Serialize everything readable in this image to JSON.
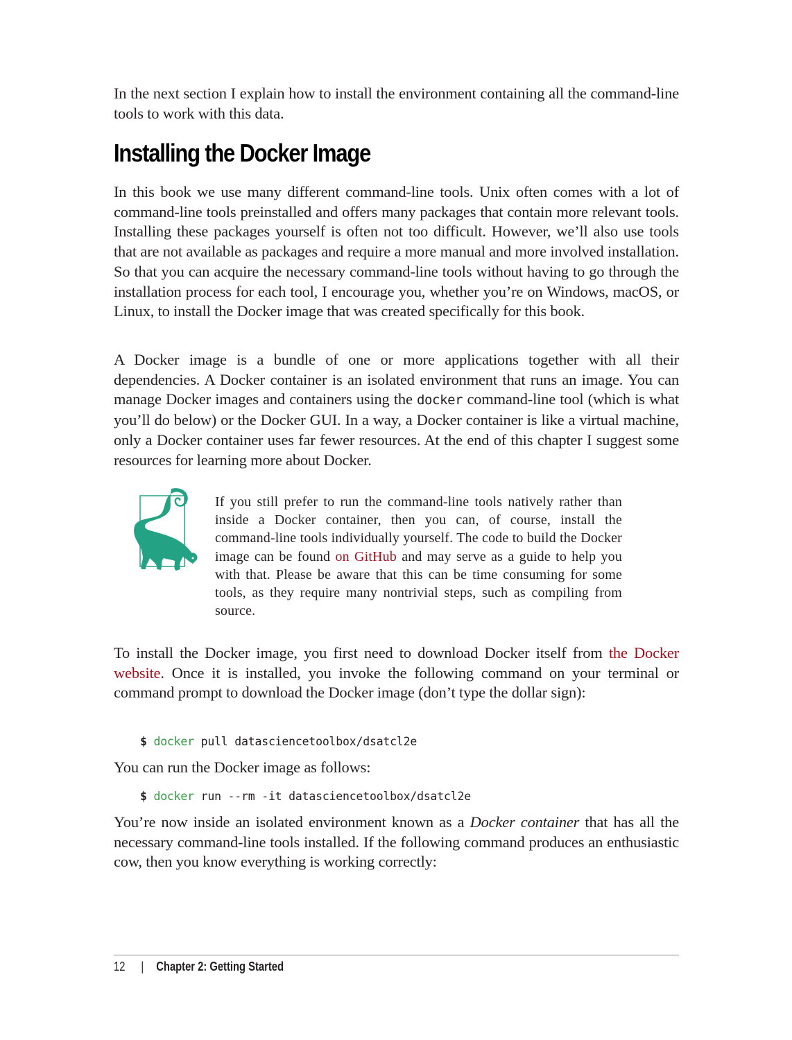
{
  "intro_paragraph": {
    "text": "In the next section I explain how to install the environment containing all the command-line tools to work with this data."
  },
  "section_heading": "Installing the Docker Image",
  "paragraph_1": "In this book we use many different command-line tools. Unix often comes with a lot of command-line tools preinstalled and offers many packages that contain more relevant tools. Installing these packages yourself is often not too difficult. However, we’ll also use tools that are not available as packages and require a more manual and more involved installation. So that you can acquire the necessary command-line tools without having to go through the installation process for each tool, I encourage you, whether you’re on Windows, macOS, or Linux, to install the Docker image that was created specifically for this book.",
  "paragraph_2": {
    "before": "A Docker image is a bundle of one or more applications together with all their dependencies. A Docker container is an isolated environment that runs an image. You can manage Docker images and containers using the ",
    "code": "docker",
    "after": " command-line tool (which is what you’ll do below) or the Docker GUI. In a way, a Docker container is like a virtual machine, only a Docker container uses far fewer resources. At the end of this chapter I suggest some resources for learning more about Docker."
  },
  "tip_note": {
    "icon": "lemur-tip-icon",
    "before": "If you still prefer to run the command-line tools natively rather than inside a Docker container, then you can, of course, install the command-line tools individually yourself. The code to build the Docker image can be found ",
    "link_text": "on GitHub",
    "after": " and may serve as a guide to help you with that. Please be aware that this can be time consuming for some tools, as they require many nontrivial steps, such as compiling from source."
  },
  "paragraph_3": {
    "before": "To install the Docker image, you first need to download Docker itself from ",
    "link_text": "the Docker website",
    "after": ". Once it is installed, you invoke the following command on your terminal or command prompt to download the Docker image (don’t type the dollar sign):"
  },
  "code_pull": {
    "prompt": "$",
    "command": "docker",
    "args": " pull datasciencetoolbox/dsatcl2e"
  },
  "paragraph_4": "You can run the Docker image as follows:",
  "code_run": {
    "prompt": "$",
    "command": "docker",
    "args": " run --rm -it datasciencetoolbox/dsatcl2e"
  },
  "paragraph_5": {
    "before": "You’re now inside an isolated environment known as a ",
    "emphasis": "Docker container",
    "after": " that has all the necessary command-line tools installed. If the following command produces an enthusiastic cow, then you know everything is working correctly:"
  },
  "footer": {
    "page_number": "12",
    "separator": "|",
    "chapter": "Chapter 2: Getting Started"
  },
  "colors": {
    "link": "#a3101c",
    "code_command": "#2e9c3f",
    "icon_green": "#23a383"
  }
}
